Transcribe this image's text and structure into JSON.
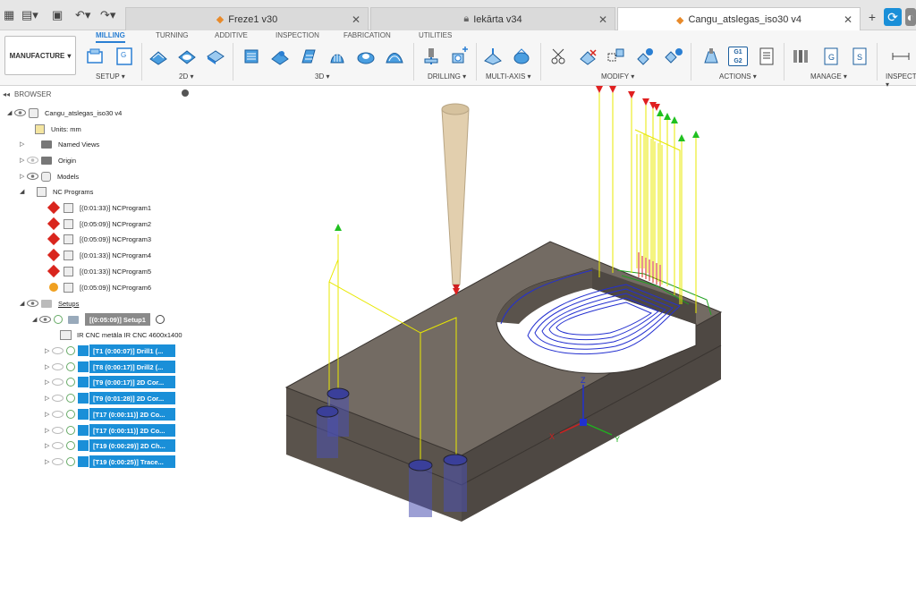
{
  "tabs": [
    {
      "label": "Freze1 v30",
      "active": false
    },
    {
      "label": "Iekārta v34",
      "active": false,
      "locked": true
    },
    {
      "label": "Cangu_atslegas_iso30 v4",
      "active": true
    }
  ],
  "ribbon": {
    "workspace": "MANUFACTURE",
    "tabs": [
      "MILLING",
      "TURNING",
      "ADDITIVE",
      "INSPECTION",
      "FABRICATION",
      "UTILITIES"
    ],
    "active_tab": "MILLING",
    "groups": [
      "SETUP ▾",
      "2D ▾",
      "3D ▾",
      "DRILLING ▾",
      "MULTI-AXIS ▾",
      "MODIFY ▾",
      "ACTIONS ▾",
      "MANAGE ▾",
      "INSPECT ▾"
    ],
    "actions_g1g2": "G1\nG2"
  },
  "browser": {
    "title": "BROWSER",
    "root": "Cangu_atslegas_iso30 v4",
    "units": "Units: mm",
    "named_views": "Named Views",
    "origin": "Origin",
    "models": "Models",
    "nc_programs": "NC Programs",
    "programs": [
      {
        "label": "[(0:01:33)] NCProgram1",
        "status": "error"
      },
      {
        "label": "[(0:05:09)] NCProgram2",
        "status": "error"
      },
      {
        "label": "[(0:05:09)] NCProgram3",
        "status": "error"
      },
      {
        "label": "[(0:01:33)] NCProgram4",
        "status": "error"
      },
      {
        "label": "[(0:01:33)] NCProgram5",
        "status": "error"
      },
      {
        "label": "[(0:05:09)] NCProgram6",
        "status": "warning"
      }
    ],
    "setups": "Setups",
    "setup1": "[(0:05:09)] Setup1",
    "machine": "IR CNC metāla IR CNC 4600x1400",
    "operations": [
      "[T1 (0:00:07)] Drill1 (...",
      "[T8 (0:00:17)] Drill2 (...",
      "[T9 (0:00:17)] 2D Cor...",
      "[T9 (0:01:28)] 2D Cor...",
      "[T17 (0:00:11)] 2D Co...",
      "[T17 (0:00:11)] 2D Co...",
      "[T19 (0:00:29)] 2D Ch...",
      "[T19 (0:00:25)] Trace..."
    ]
  },
  "triad": {
    "x": "X",
    "y": "Y",
    "z": "Z"
  },
  "colors": {
    "accent": "#2a7fd3",
    "op_blue": "#1a8fd8",
    "error": "#d9251d",
    "warning": "#f0a020",
    "block": "#5a534c",
    "rapid": "#e8e800",
    "cut": "#2430d0",
    "lead": "#20a020"
  }
}
